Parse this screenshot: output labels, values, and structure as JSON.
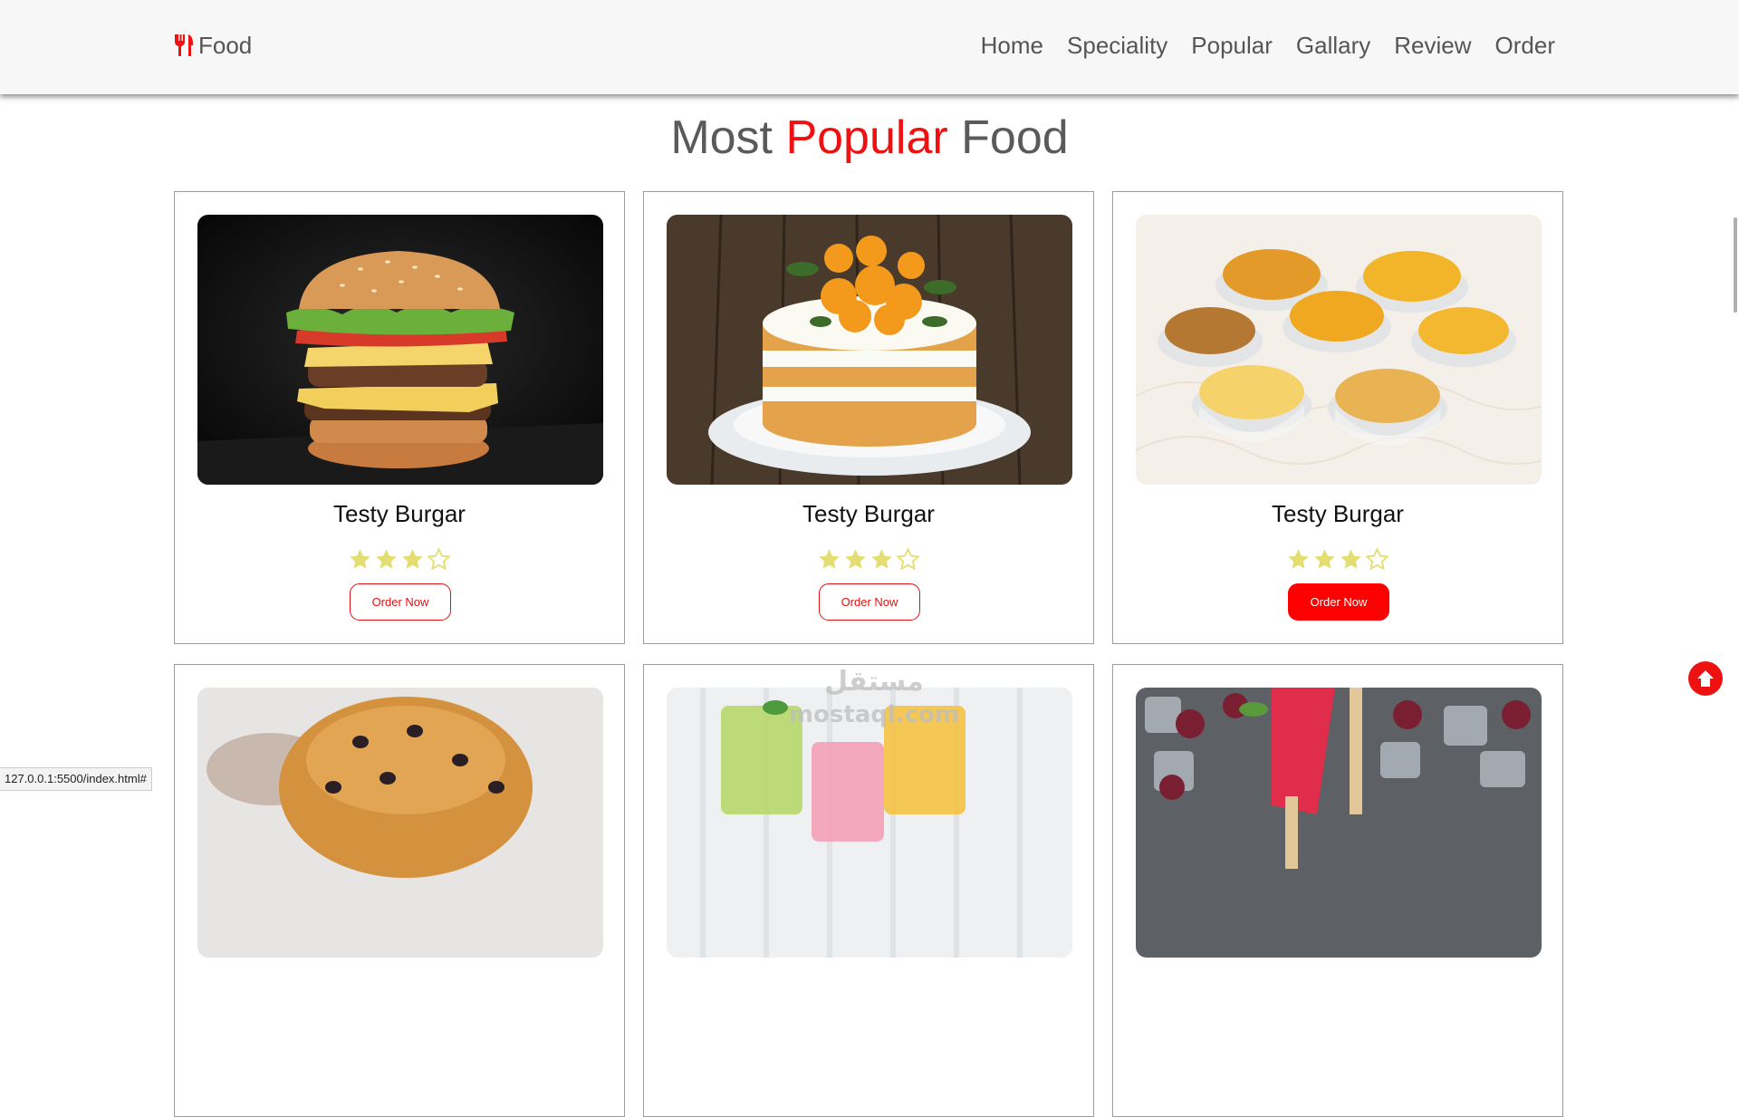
{
  "navbar": {
    "brand": "Food",
    "links": [
      "Home",
      "Speciality",
      "Popular",
      "Gallary",
      "Review",
      "Order"
    ]
  },
  "section": {
    "title_part1": "Most",
    "title_accent": "Popular",
    "title_part2": "Food",
    "accent_color": "#ee1111"
  },
  "cards": [
    {
      "title": "Testy Burgar",
      "rating": 3,
      "max_rating": 4,
      "button": "Order Now",
      "image": "burger"
    },
    {
      "title": "Testy Burgar",
      "rating": 3,
      "max_rating": 4,
      "button": "Order Now",
      "image": "orange-cake"
    },
    {
      "title": "Testy Burgar",
      "rating": 3,
      "max_rating": 4,
      "button": "Order Now",
      "image": "snacks-bowls",
      "highlighted": true
    },
    {
      "image": "muffin"
    },
    {
      "image": "smoothie-glasses"
    },
    {
      "image": "ice-pops-berries"
    }
  ],
  "star_color": "#e3dd72",
  "button_color": "#ff0000",
  "status_bar": {
    "url": "127.0.0.1:5500/index.html#"
  },
  "watermark": {
    "line1": "مستقل",
    "line2": "mostaql.com"
  }
}
